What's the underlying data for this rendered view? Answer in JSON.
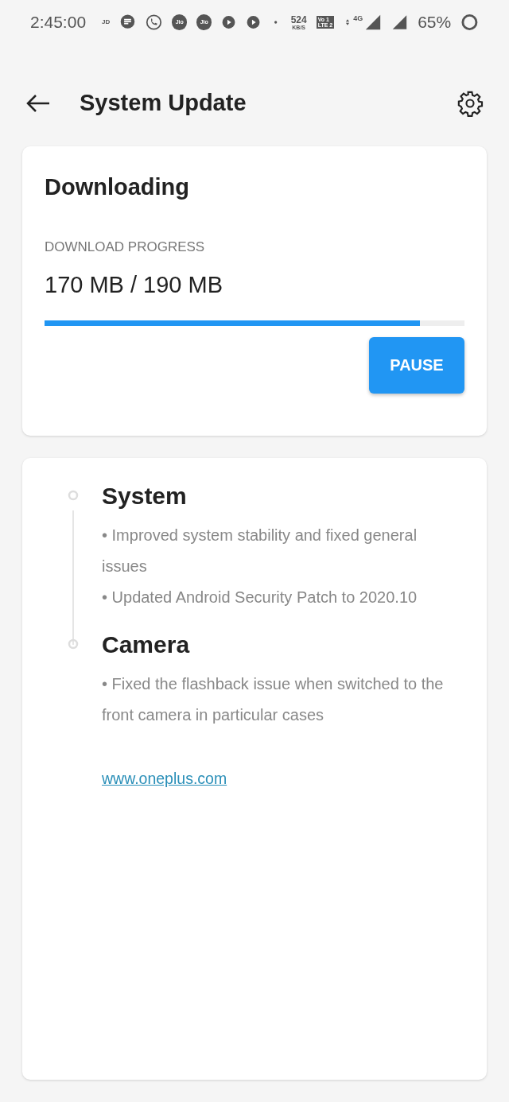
{
  "status_bar": {
    "time": "2:45:00",
    "jd": "JD",
    "jio": [
      "Jio",
      "Jio"
    ],
    "speed": "524",
    "speed_unit": "KB/S",
    "volte": [
      "Vo 1",
      "LTE 2"
    ],
    "network": "4G",
    "battery": "65%"
  },
  "header": {
    "title": "System Update"
  },
  "download": {
    "title": "Downloading",
    "label": "DOWNLOAD PROGRESS",
    "amount": "170 MB / 190 MB",
    "level": 0.8943,
    "button": "PAUSE"
  },
  "notes": [
    {
      "title": "System",
      "lines": [
        "• Improved system stability and fixed general issues",
        "• Updated Android Security Patch to 2020.10"
      ]
    },
    {
      "title": "Camera",
      "lines": [
        "• Fixed the flashback issue when switched to the front camera in particular cases"
      ]
    }
  ],
  "link": "www.oneplus.com"
}
